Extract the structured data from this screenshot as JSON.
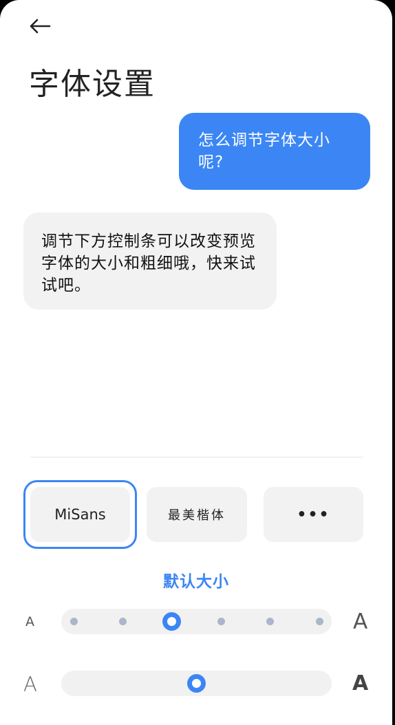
{
  "page": {
    "title": "字体设置"
  },
  "icons": {
    "back": "arrow-left-icon",
    "more": "more-dots-icon"
  },
  "colors": {
    "accent": "#3b86f4",
    "bubble_bot_bg": "#f2f2f2",
    "track_bg": "#f1f1f1",
    "dot": "#a9b6cc"
  },
  "chat": {
    "user_message": "怎么调节字体大小呢?",
    "bot_message": "调节下方控制条可以改变预览字体的大小和粗细哦，快来试试吧。"
  },
  "fonts": {
    "options": [
      {
        "label": "MiSans",
        "selected": true
      },
      {
        "label": "最美楷体",
        "selected": false
      },
      {
        "label": "•••",
        "selected": false
      }
    ]
  },
  "size": {
    "label": "默认大小",
    "min_glyph": "A",
    "max_glyph": "A",
    "steps": 6,
    "selected_step": 3
  },
  "weight": {
    "min_glyph": "A",
    "max_glyph": "A",
    "value_fraction": 0.5
  }
}
